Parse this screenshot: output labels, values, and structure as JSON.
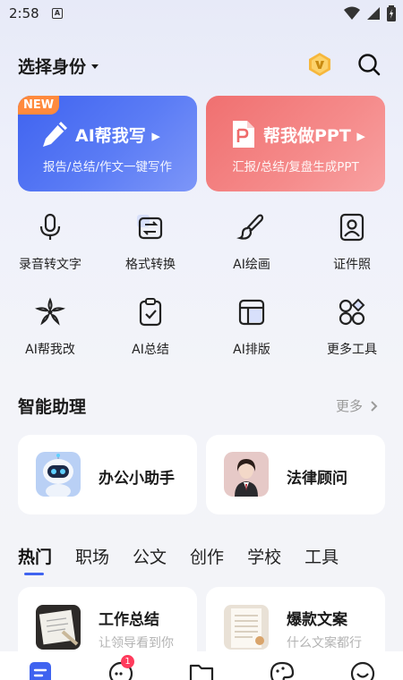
{
  "status_bar": {
    "time": "2:58",
    "notif_letter": "A"
  },
  "header": {
    "identity_label": "选择身份"
  },
  "feature_cards": [
    {
      "badge": "NEW",
      "title": "AI帮我写",
      "subtitle": "报告/总结/作文一键写作"
    },
    {
      "title": "帮我做PPT",
      "subtitle": "汇报/总结/复盘生成PPT"
    }
  ],
  "tools": [
    {
      "label": "录音转文字",
      "icon": "microphone-icon"
    },
    {
      "label": "格式转换",
      "icon": "format-convert-icon"
    },
    {
      "label": "AI绘画",
      "icon": "paint-brush-icon"
    },
    {
      "label": "证件照",
      "icon": "id-photo-icon"
    },
    {
      "label": "AI帮我改",
      "icon": "ai-edit-icon"
    },
    {
      "label": "AI总结",
      "icon": "clipboard-check-icon"
    },
    {
      "label": "AI排版",
      "icon": "layout-icon"
    },
    {
      "label": "更多工具",
      "icon": "more-tools-icon"
    }
  ],
  "assistant_section": {
    "title": "智能助理",
    "more": "更多"
  },
  "assistants": [
    {
      "name": "办公小助手"
    },
    {
      "name": "法律顾问"
    }
  ],
  "category_tabs": [
    {
      "label": "热门",
      "active": true
    },
    {
      "label": "职场"
    },
    {
      "label": "公文"
    },
    {
      "label": "创作"
    },
    {
      "label": "学校"
    },
    {
      "label": "工具"
    }
  ],
  "templates": [
    {
      "title": "工作总结",
      "desc": "让领导看到你"
    },
    {
      "title": "爆款文案",
      "desc": "什么文案都行"
    }
  ],
  "bottom_nav": {
    "message_badge": "1"
  },
  "colors": {
    "accent": "#3f63f0",
    "ppt": "#f07070",
    "badge": "#ff3b5c",
    "new_badge": "#ff8a3d"
  }
}
